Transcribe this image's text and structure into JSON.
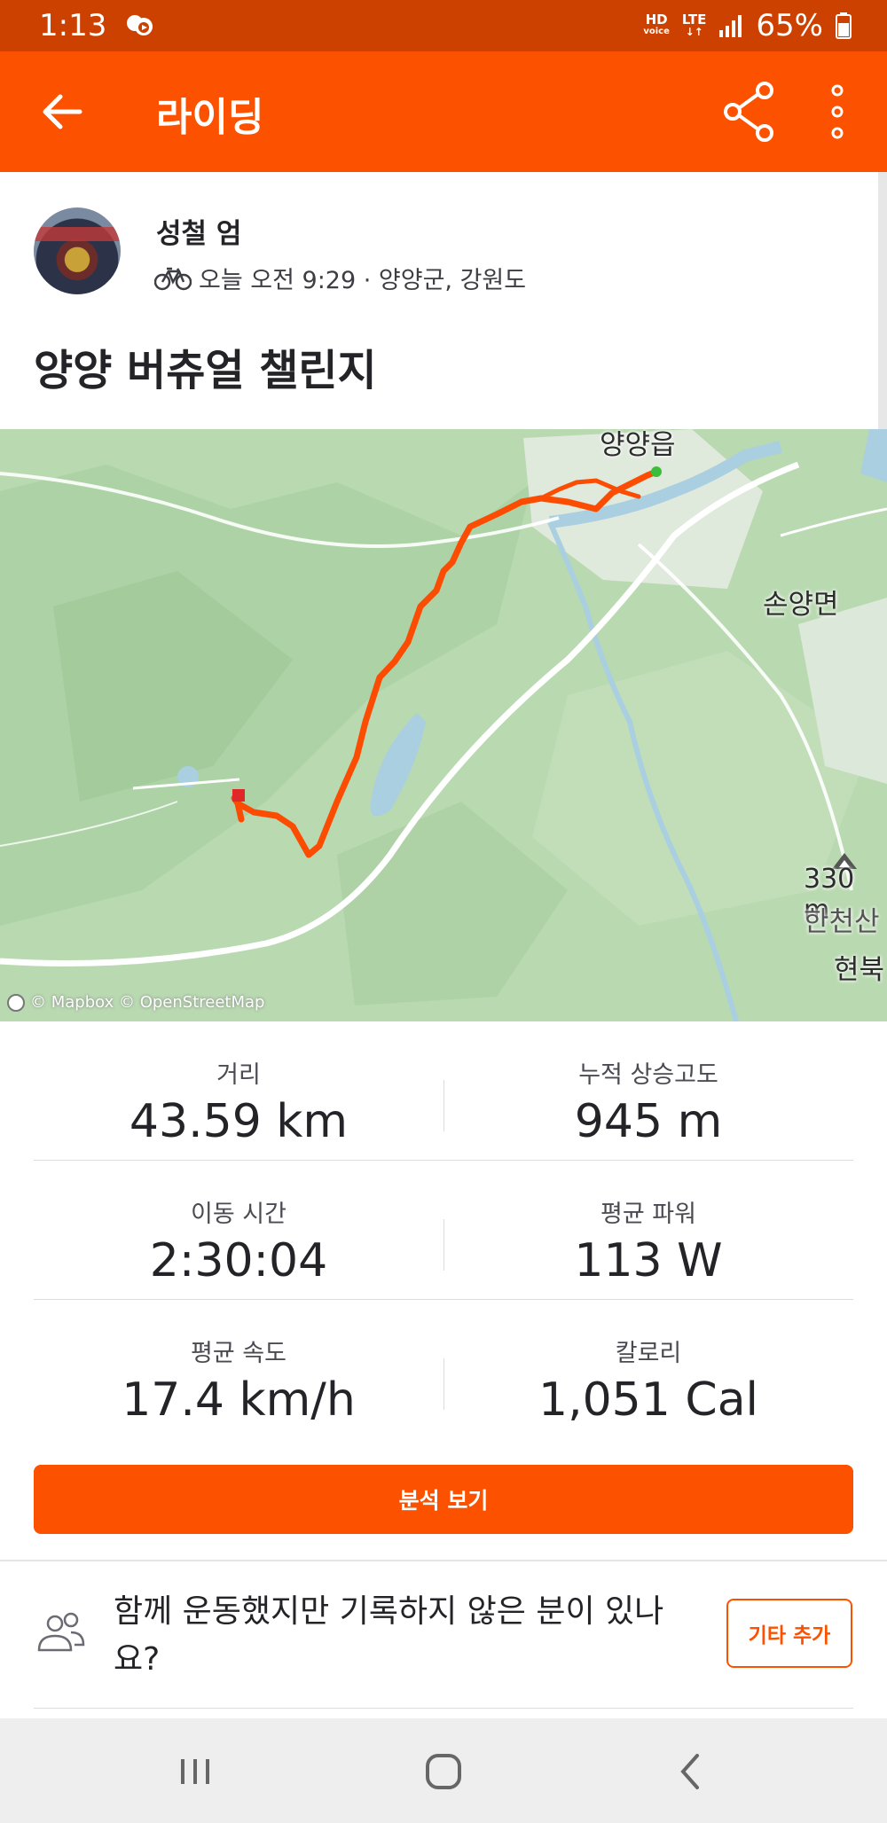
{
  "status_bar": {
    "time": "1:13",
    "hd_top": "HD",
    "hd_bottom": "voice",
    "lte": "LTE",
    "battery": "65%"
  },
  "app_bar": {
    "title": "라이딩",
    "icons": [
      "arrow-left-icon",
      "share-icon",
      "more-vertical-icon"
    ]
  },
  "activity": {
    "athlete_name": "성철 엄",
    "meta": "오늘 오전 9:29 · 양양군, 강원도",
    "title": "양양 버츄얼 챌린지",
    "sport_icon": "bicycle-icon"
  },
  "map": {
    "labels": [
      "양양읍",
      "손양면",
      "330 m",
      "한천산",
      "현북"
    ],
    "attribution": "© Mapbox © OpenStreetMap",
    "route_color": "#fc4c02"
  },
  "stats": [
    {
      "label": "거리",
      "value": "43.59 km"
    },
    {
      "label": "누적 상승고도",
      "value": "945 m"
    },
    {
      "label": "이동 시간",
      "value": "2:30:04"
    },
    {
      "label": "평균 파워",
      "value": "113 W"
    },
    {
      "label": "평균 속도",
      "value": "17.4 km/h"
    },
    {
      "label": "칼로리",
      "value": "1,051 Cal"
    }
  ],
  "analysis_button": "분석 보기",
  "others_prompt": {
    "text": "함께 운동했지만 기록하지 않은 분이 있나요?",
    "button": "기타 추가"
  },
  "colors": {
    "brand": "#fc5200",
    "status_bar": "#cc4000"
  },
  "nav_bar": [
    "recents-icon",
    "home-icon",
    "back-icon"
  ]
}
